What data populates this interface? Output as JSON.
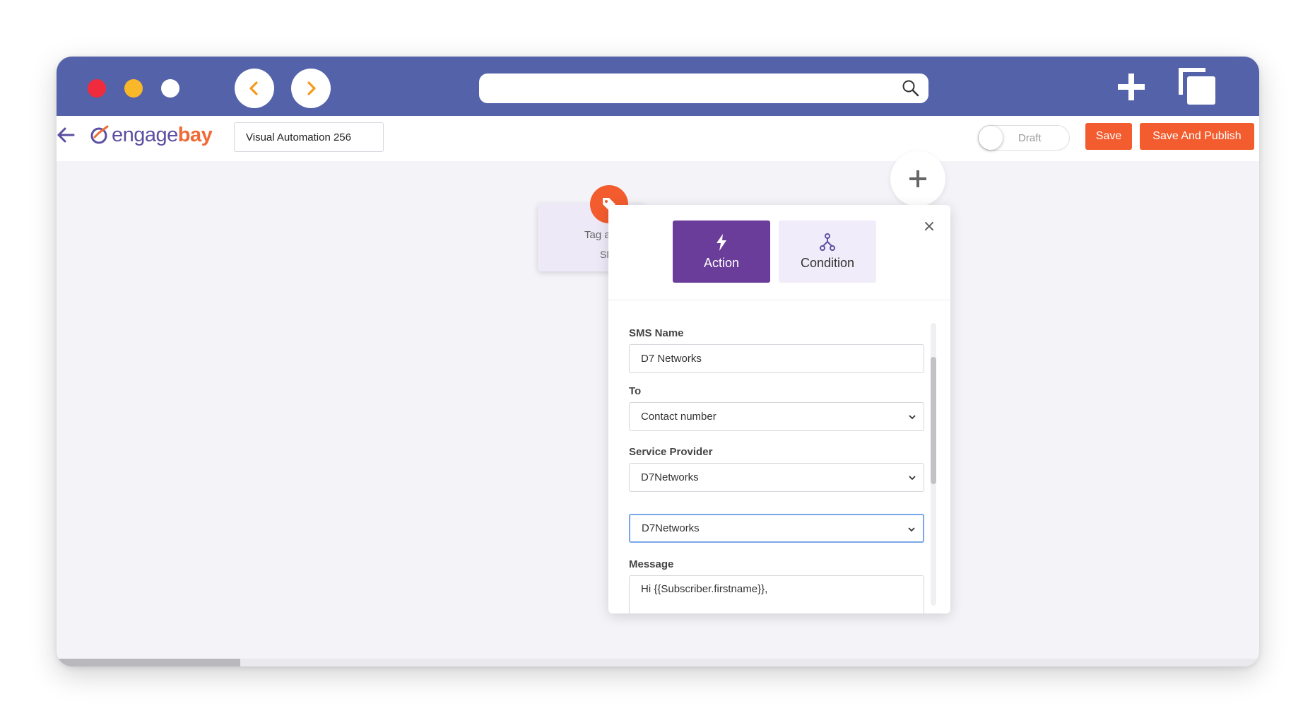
{
  "browser": {
    "back_icon": "chevron-left-icon",
    "forward_icon": "chevron-right-icon",
    "search_placeholder": "",
    "new_tab_icon": "plus-icon",
    "windows_icon": "copy-icon",
    "colors": {
      "titlebar": "#5462aa",
      "close": "#f02b3d",
      "minimize": "#f9b72a",
      "maximize": "#ffffff"
    }
  },
  "app": {
    "logo_prefix": "engage",
    "logo_suffix": "bay",
    "automation_name": "Visual Automation 256",
    "draft_label": "Draft",
    "draft_on": false,
    "save_label": "Save",
    "publish_label": "Save And Publish",
    "accent_color": "#f25c2e",
    "brand_purple": "#6b3d9a"
  },
  "canvas": {
    "node": {
      "title": "Tag a",
      "subtitle": "SM",
      "icon": "tag-icon"
    },
    "add_node_icon": "plus-icon"
  },
  "popup": {
    "tabs": [
      {
        "label": "Action",
        "icon": "lightning-icon",
        "active": true
      },
      {
        "label": "Condition",
        "icon": "branch-icon",
        "active": false
      }
    ],
    "close_icon": "close-icon",
    "fields": {
      "sms_name": {
        "label": "SMS Name",
        "value": "D7 Networks"
      },
      "to": {
        "label": "To",
        "value": "Contact number"
      },
      "service_provider": {
        "label": "Service Provider",
        "value": "D7Networks"
      },
      "provider_account": {
        "value": "D7Networks"
      },
      "message": {
        "label": "Message",
        "value": "Hi {{Subscriber.firstname}},"
      }
    }
  }
}
